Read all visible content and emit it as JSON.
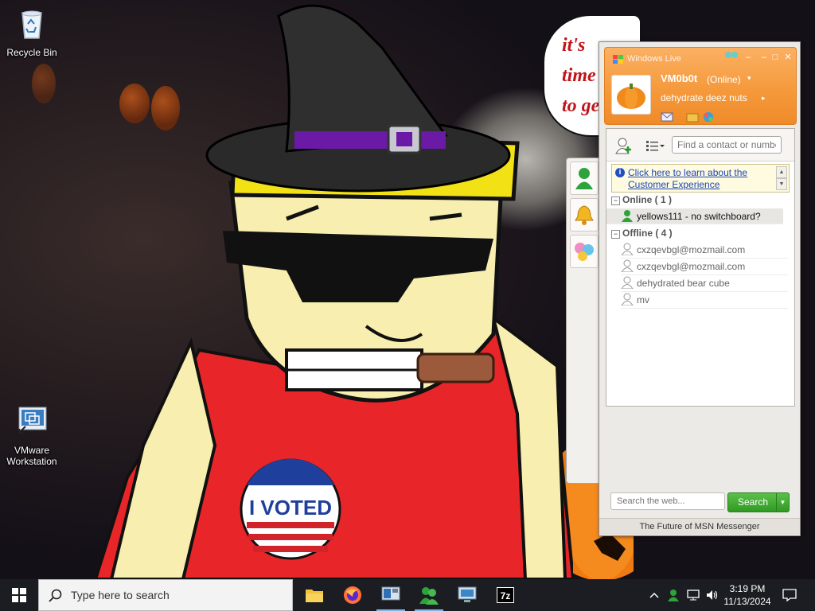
{
  "desktop": {
    "icons": [
      {
        "label": "Recycle Bin"
      },
      {
        "label": "VMware Workstation"
      }
    ],
    "wallpaper_text": "it's time to get shit and or t"
  },
  "msn": {
    "title": "Windows Live",
    "display_name": "VM0b0t",
    "status": "(Online)",
    "personal_message": "dehydrate deez nuts",
    "find_placeholder": "Find a contact or number",
    "info_link": "Click here to learn about the Customer Experience",
    "groups": {
      "online": {
        "label": "Online ( 1 )"
      },
      "offline": {
        "label": "Offline ( 4 )"
      }
    },
    "contacts_online": [
      "yellows111 - no switchboard?"
    ],
    "contacts_offline": [
      "cxzqevbgl@mozmail.com",
      "cxzqevbgl@mozmail.com",
      "dehydrated bear cube",
      "mv"
    ],
    "search_placeholder": "Search the web...",
    "search_button": "Search",
    "footer": "The Future of MSN Messenger"
  },
  "taskbar": {
    "search_placeholder": "Type here to search",
    "apps": [
      "file-explorer",
      "firefox",
      "vmware-workstation",
      "msn-messenger",
      "remote-desktop",
      "7-zip"
    ],
    "clock_time": "3:19 PM",
    "clock_date": "11/13/2024"
  },
  "colors": {
    "msn_orange": "#f59a3c",
    "search_green": "#3aa52b",
    "taskbar": "#1b1d22"
  }
}
